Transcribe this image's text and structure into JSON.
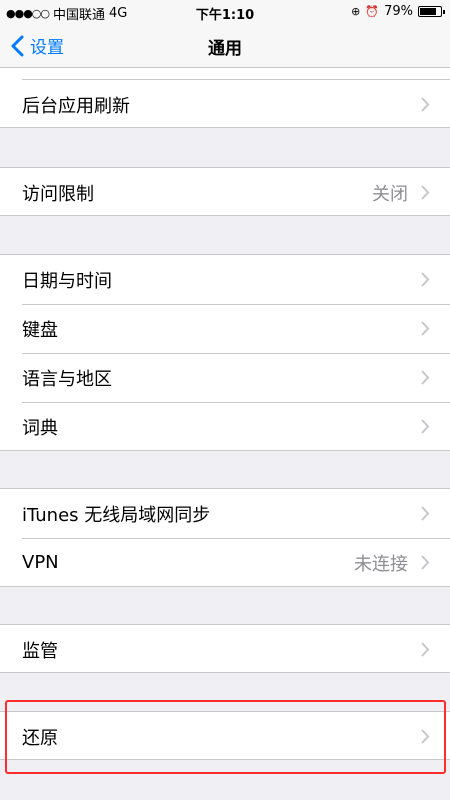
{
  "status_bar": {
    "signal": "●●●○○",
    "carrier": "中国联通",
    "network": "4G",
    "time": "下午1:10",
    "battery": "79%",
    "battery_level": 0.79
  },
  "nav": {
    "back_label": "设置",
    "title": "通用"
  },
  "rows": {
    "background_refresh": {
      "label": "后台应用刷新"
    },
    "restrictions": {
      "label": "访问限制",
      "value": "关闭"
    },
    "date_time": {
      "label": "日期与时间"
    },
    "keyboard": {
      "label": "键盘"
    },
    "language_region": {
      "label": "语言与地区"
    },
    "dictionary": {
      "label": "词典"
    },
    "itunes_wifi_sync": {
      "label": "iTunes 无线局域网同步"
    },
    "vpn": {
      "label": "VPN",
      "value": "未连接"
    },
    "supervision": {
      "label": "监管"
    },
    "reset": {
      "label": "还原"
    }
  },
  "colors": {
    "accent": "#007aff",
    "highlight_box": "#ff2d2d"
  }
}
